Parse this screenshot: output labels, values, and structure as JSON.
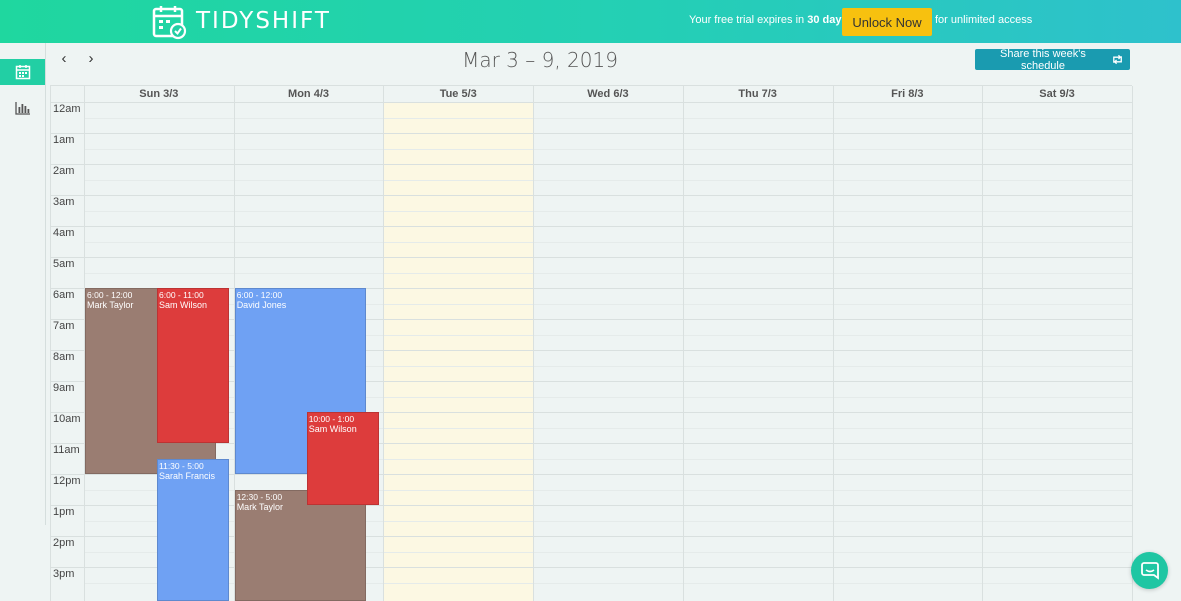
{
  "header": {
    "brand": "TIDYSHIFT",
    "trial_prefix": "Your free trial expires in",
    "trial_days": "30 days",
    "unlock_label": "Unlock Now",
    "trial_suffix": "for unlimited access"
  },
  "sidebar": {
    "items": [
      {
        "name": "calendar-icon",
        "active": true
      },
      {
        "name": "bar-chart-icon",
        "active": false
      }
    ]
  },
  "toolbar": {
    "prev_icon": "‹",
    "next_icon": "›",
    "week_title": "Mar 3 – 9, 2019",
    "share_label": "Share this week's schedule"
  },
  "days": [
    "Sun 3/3",
    "Mon 4/3",
    "Tue 5/3",
    "Wed 6/3",
    "Thu 7/3",
    "Fri 8/3",
    "Sat 9/3"
  ],
  "today_index": 2,
  "hours": [
    "12am",
    "1am",
    "2am",
    "3am",
    "4am",
    "5am",
    "6am",
    "7am",
    "8am",
    "9am",
    "10am",
    "11am",
    "12pm",
    "1pm",
    "2pm",
    "3pm"
  ],
  "events": [
    {
      "day": 0,
      "start": 6.0,
      "end": 12.0,
      "time": "6:00 - 12:00",
      "name": "Mark Taylor",
      "color": "#9a7d72",
      "slot": 0
    },
    {
      "day": 0,
      "start": 6.0,
      "end": 11.0,
      "time": "6:00 - 11:00",
      "name": "Sam Wilson",
      "color": "#dd3c3c",
      "slot": 1
    },
    {
      "day": 0,
      "start": 11.5,
      "end": 17.0,
      "time": "11:30 - 5:00",
      "name": "Sarah Francis",
      "color": "#6fa1f3",
      "slot": 1
    },
    {
      "day": 1,
      "start": 6.0,
      "end": 12.0,
      "time": "6:00 - 12:00",
      "name": "David Jones",
      "color": "#6fa1f3",
      "slot": 0
    },
    {
      "day": 1,
      "start": 10.0,
      "end": 13.0,
      "time": "10:00 - 1:00",
      "name": "Sam Wilson",
      "color": "#dd3c3c",
      "slot": 1
    },
    {
      "day": 1,
      "start": 12.5,
      "end": 17.0,
      "time": "12:30 - 5:00",
      "name": "Mark Taylor",
      "color": "#9a7d72",
      "slot": 0
    }
  ],
  "colors": {
    "accent": "#22cfa4",
    "today": "#fcf8e3",
    "share": "#1a9bb0",
    "unlock": "#f7c10f"
  }
}
